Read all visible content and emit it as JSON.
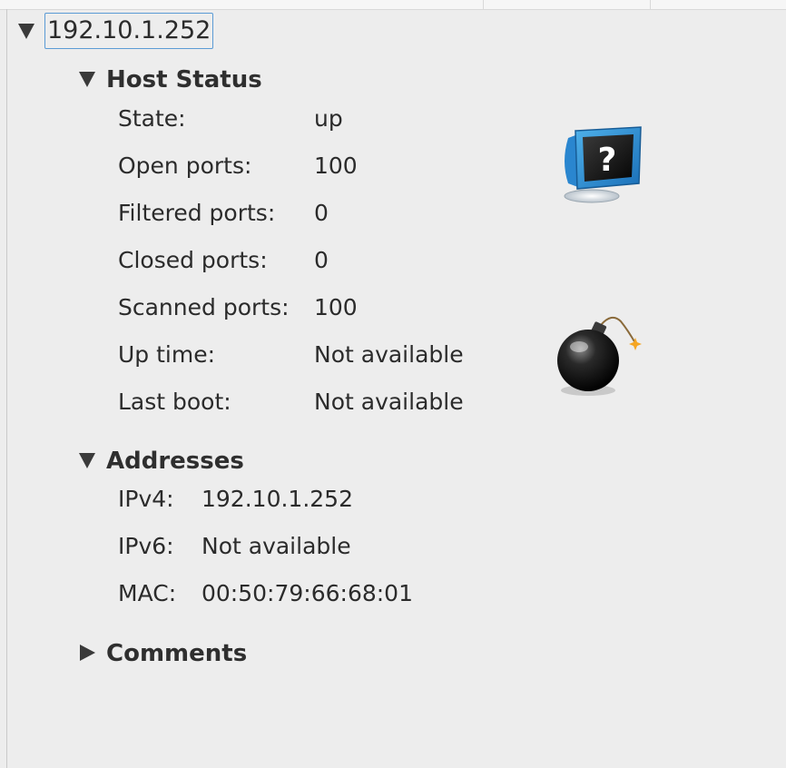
{
  "host": {
    "address": "192.10.1.252"
  },
  "host_status": {
    "title": "Host Status",
    "rows": [
      {
        "label": "State:",
        "value": "up"
      },
      {
        "label": "Open ports:",
        "value": "100"
      },
      {
        "label": "Filtered ports:",
        "value": "0"
      },
      {
        "label": "Closed ports:",
        "value": "0"
      },
      {
        "label": "Scanned ports:",
        "value": "100"
      },
      {
        "label": "Up time:",
        "value": "Not available"
      },
      {
        "label": "Last boot:",
        "value": "Not available"
      }
    ],
    "icons": [
      "unknown-os-monitor-icon",
      "bomb-icon"
    ]
  },
  "addresses": {
    "title": "Addresses",
    "rows": [
      {
        "label": "IPv4:",
        "value": "192.10.1.252"
      },
      {
        "label": "IPv6:",
        "value": "Not available"
      },
      {
        "label": "MAC:",
        "value": "00:50:79:66:68:01"
      }
    ]
  },
  "comments": {
    "title": "Comments"
  },
  "colors": {
    "background": "#ededed",
    "selection_border": "#5b9bd5",
    "text": "#2b2b2b"
  }
}
